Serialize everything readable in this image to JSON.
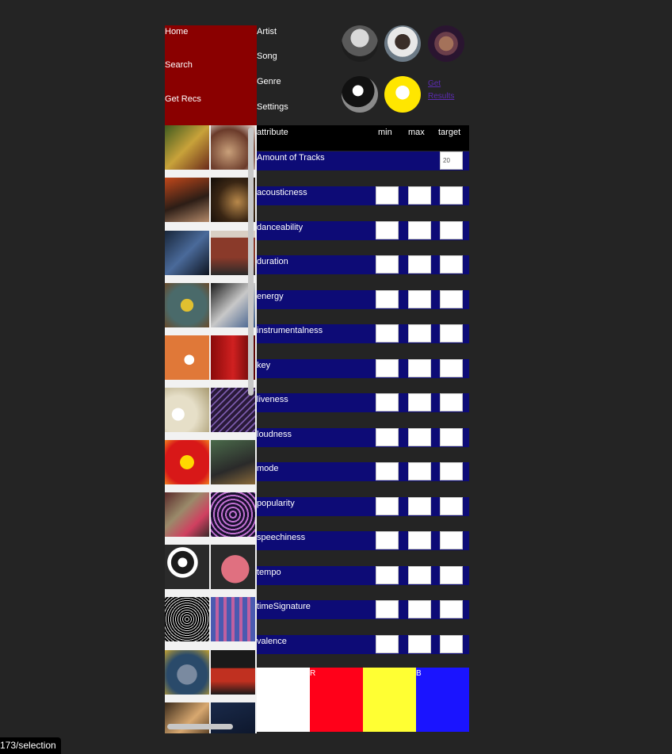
{
  "nav": {
    "home": "Home",
    "search": "Search",
    "get_recs": "Get Recs"
  },
  "search_types": {
    "artist": "Artist",
    "song": "Song",
    "genre": "Genre",
    "settings": "Settings"
  },
  "seeds": {
    "get_results": "Get Results"
  },
  "table": {
    "headers": {
      "attribute": "attribute",
      "min": "min",
      "max": "max",
      "target": "target"
    },
    "amount_label": "Amount of Tracks",
    "amount_value": "20",
    "rows": [
      "acousticness",
      "danceability",
      "duration",
      "energy",
      "instrumentalness",
      "key",
      "liveness",
      "loudness",
      "mode",
      "popularity",
      "speechiness",
      "tempo",
      "timeSignature",
      "valence"
    ]
  },
  "color_swatches": {
    "labels": [
      "R",
      "B"
    ],
    "colors": [
      "#ffffff",
      "#ff0019",
      "#ffff33",
      "#1a14ff"
    ]
  },
  "status_bar": {
    "url": "173/selection"
  }
}
